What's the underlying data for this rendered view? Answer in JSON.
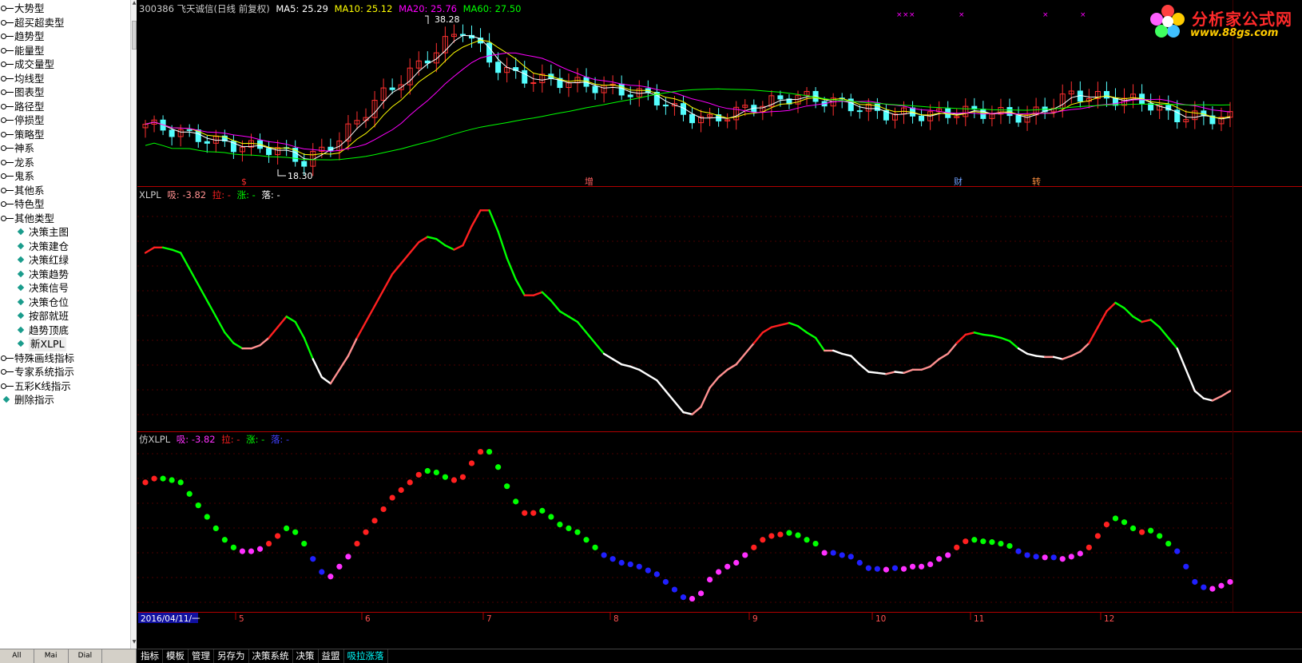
{
  "tree": {
    "items": [
      {
        "label": "大势型",
        "type": "folder"
      },
      {
        "label": "超买超卖型",
        "type": "folder"
      },
      {
        "label": "趋势型",
        "type": "folder"
      },
      {
        "label": "能量型",
        "type": "folder"
      },
      {
        "label": "成交量型",
        "type": "folder"
      },
      {
        "label": "均线型",
        "type": "folder"
      },
      {
        "label": "图表型",
        "type": "folder"
      },
      {
        "label": "路径型",
        "type": "folder"
      },
      {
        "label": "停损型",
        "type": "folder"
      },
      {
        "label": "策略型",
        "type": "folder"
      },
      {
        "label": "神系",
        "type": "folder"
      },
      {
        "label": "龙系",
        "type": "folder"
      },
      {
        "label": "鬼系",
        "type": "folder"
      },
      {
        "label": "其他系",
        "type": "folder"
      },
      {
        "label": "特色型",
        "type": "folder"
      },
      {
        "label": "其他类型",
        "type": "folder"
      },
      {
        "label": "决策主图",
        "type": "leaf"
      },
      {
        "label": "决策建仓",
        "type": "leaf"
      },
      {
        "label": "决策红绿",
        "type": "leaf"
      },
      {
        "label": "决策趋势",
        "type": "leaf"
      },
      {
        "label": "决策信号",
        "type": "leaf"
      },
      {
        "label": "决策仓位",
        "type": "leaf"
      },
      {
        "label": "按部就班",
        "type": "leaf"
      },
      {
        "label": "趋势顶底",
        "type": "leaf"
      },
      {
        "label": "新XLPL",
        "type": "leaf",
        "selected": true
      },
      {
        "label": "特殊画线指标",
        "type": "folder"
      },
      {
        "label": "专家系统指示",
        "type": "folder"
      },
      {
        "label": "五彩K线指示",
        "type": "folder"
      },
      {
        "label": "删除指示",
        "type": "leafroot"
      }
    ],
    "close_symbol": "×",
    "bottom_tabs": [
      "All",
      "Mai",
      "Dial",
      ""
    ]
  },
  "main_panel": {
    "title": "300386 飞天诚信(日线 前复权)",
    "ma5_label": "MA5: 25.29",
    "ma10_label": "MA10: 25.12",
    "ma20_label": "MA20: 25.76",
    "ma60_label": "MA60: 27.50",
    "high_label": "38.28",
    "low_label": "18.30",
    "markers": [
      {
        "text": "$",
        "color": "#ff3030"
      },
      {
        "text": "增",
        "color": "#ff6060"
      },
      {
        "text": "财",
        "color": "#6fa0ff"
      },
      {
        "text": "转",
        "color": "#ff9040"
      }
    ],
    "colors": {
      "ma5": "#ffffff",
      "ma10": "#ffff00",
      "ma20": "#ff00ff",
      "ma60": "#00ff00",
      "up": "#ff3030",
      "down": "#54ffff"
    }
  },
  "xlpl_panel": {
    "name": "XLPL",
    "xi": "吸: -3.82",
    "la": "拉: -",
    "zhang": "涨: -",
    "luo": "落: -",
    "colors": {
      "xi": "#ff9090",
      "la": "#ff2020",
      "zhang": "#00ff00",
      "luo": "#ffffff"
    }
  },
  "fxlpl_panel": {
    "name": "仿XLPL",
    "xi": "吸: -3.82",
    "la": "拉: -",
    "zhang": "涨: -",
    "luo": "落: -",
    "colors": {
      "xi": "#ff30ff",
      "la": "#ff2020",
      "zhang": "#00ff00",
      "luo": "#2020ff"
    }
  },
  "x_axis": {
    "date_box": "2016/04/11/一",
    "months": [
      "5",
      "6",
      "7",
      "8",
      "9",
      "10",
      "11",
      "12"
    ]
  },
  "bottom_tabs": [
    "指标",
    "模板",
    "管理",
    "另存为",
    "决策系统",
    "决策",
    "益盟",
    "吸拉涨落"
  ],
  "active_bottom_tab": "吸拉涨落",
  "logo": {
    "name": "分析家公式网",
    "url": "www.88gs.com"
  },
  "chart_data": [
    {
      "type": "candlestick",
      "title": "300386 飞天诚信(日线 前复权)",
      "series_names": [
        "MA5",
        "MA10",
        "MA20",
        "MA60"
      ],
      "latest": {
        "MA5": 25.29,
        "MA10": 25.12,
        "MA20": 25.76,
        "MA60": 27.5
      },
      "price_high": 38.28,
      "price_low": 18.3,
      "ylim": [
        17,
        40
      ],
      "x_categories": [
        "4",
        "5",
        "6",
        "7",
        "8",
        "9",
        "10",
        "11",
        "12"
      ]
    },
    {
      "type": "line",
      "title": "XLPL",
      "legend": [
        "吸",
        "拉",
        "涨",
        "落"
      ],
      "values": [
        21.5,
        22,
        22,
        21.8,
        21.5,
        20,
        18.5,
        17,
        15.5,
        14,
        13,
        12.5,
        12.5,
        12.8,
        13.5,
        14.5,
        15.5,
        15,
        13.5,
        11.5,
        9.8,
        9.2,
        10.5,
        11.8,
        13.5,
        15,
        16.5,
        18,
        19.5,
        20.5,
        21.5,
        22.5,
        23,
        22.8,
        22.2,
        21.8,
        22.2,
        24,
        25.5,
        25.5,
        23.5,
        21,
        19,
        17.5,
        17.5,
        17.8,
        17,
        16,
        15.5,
        15,
        14,
        13,
        12,
        11.5,
        11,
        10.8,
        10.5,
        10,
        9.5,
        8.5,
        7.5,
        6.5,
        6.3,
        7,
        8.8,
        9.8,
        10.5,
        11,
        12,
        13,
        14,
        14.5,
        14.7,
        14.9,
        14.6,
        14,
        13.5,
        12.3,
        12.3,
        12,
        11.8,
        11,
        10.3,
        10.2,
        10.1,
        10.3,
        10.2,
        10.5,
        10.5,
        10.8,
        11.5,
        12,
        13,
        13.8,
        14,
        13.8,
        13.7,
        13.5,
        13.2,
        12.5,
        12,
        11.8,
        11.7,
        11.7,
        11.5,
        11.8,
        12.2,
        13,
        14.5,
        16,
        16.8,
        16.3,
        15.5,
        15,
        15.2,
        14.5,
        13.5,
        12.5,
        10.5,
        8.5,
        7.8,
        7.6,
        8,
        8.5,
        9,
        9.8,
        10.2
      ]
    },
    {
      "type": "scatter",
      "title": "仿XLPL",
      "legend": [
        "吸",
        "拉",
        "涨",
        "落"
      ],
      "values": [
        21.5,
        22,
        22,
        21.8,
        21.5,
        20,
        18.5,
        17,
        15.5,
        14,
        13,
        12.5,
        12.5,
        12.8,
        13.5,
        14.5,
        15.5,
        15,
        13.5,
        11.5,
        9.8,
        9.2,
        10.5,
        11.8,
        13.5,
        15,
        16.5,
        18,
        19.5,
        20.5,
        21.5,
        22.5,
        23,
        22.8,
        22.2,
        21.8,
        22.2,
        24,
        25.5,
        25.5,
        23.5,
        21,
        19,
        17.5,
        17.5,
        17.8,
        17,
        16,
        15.5,
        15,
        14,
        13,
        12,
        11.5,
        11,
        10.8,
        10.5,
        10,
        9.5,
        8.5,
        7.5,
        6.5,
        6.3,
        7,
        8.8,
        9.8,
        10.5,
        11,
        12,
        13,
        14,
        14.5,
        14.7,
        14.9,
        14.6,
        14,
        13.5,
        12.3,
        12.3,
        12,
        11.8,
        11,
        10.3,
        10.2,
        10.1,
        10.3,
        10.2,
        10.5,
        10.5,
        10.8,
        11.5,
        12,
        13,
        13.8,
        14,
        13.8,
        13.7,
        13.5,
        13.2,
        12.5,
        12,
        11.8,
        11.7,
        11.7,
        11.5,
        11.8,
        12.2,
        13,
        14.5,
        16,
        16.8,
        16.3,
        15.5,
        15,
        15.2,
        14.5,
        13.5,
        12.5,
        10.5,
        8.5,
        7.8,
        7.6,
        8,
        8.5,
        9,
        9.8,
        10.2
      ]
    }
  ]
}
